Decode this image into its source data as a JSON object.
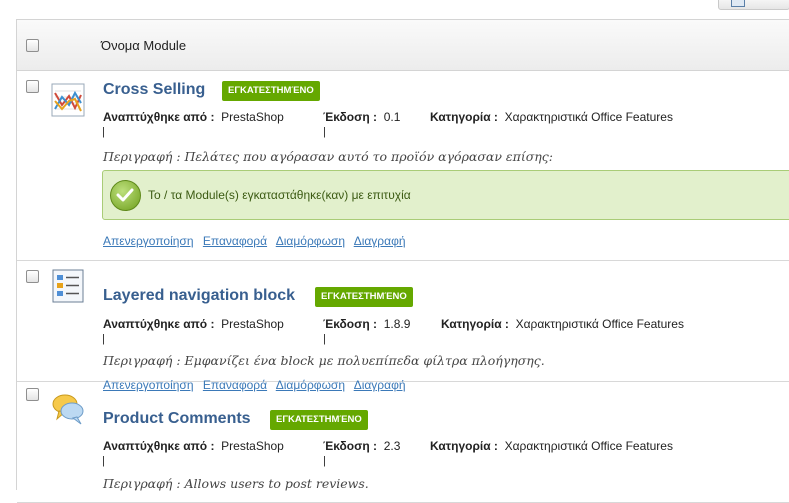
{
  "table": {
    "header_label": "Όνομα Module"
  },
  "labels": {
    "badge": "ΕΓΚΑΤΕΣΤΗΜΈΝΟ",
    "author": "Αναπτύχθηκε από :",
    "version": "Έκδοση :",
    "category": "Κατηγορία :",
    "desc_prefix": "Περιγραφή :"
  },
  "modules": [
    {
      "name": "Cross Selling",
      "author": "PrestaShop",
      "version": "0.1",
      "category": "Χαρακτηριστικά Office Features",
      "description": "Πελάτες που αγόρασαν αυτό το προϊόν αγόρασαν επίσης:",
      "icon": "cross-selling-chart-icon"
    },
    {
      "name": "Layered navigation block",
      "author": "PrestaShop",
      "version": "1.8.9",
      "category": "Χαρακτηριστικά Office Features",
      "description": "Εμφανίζει ένα block με πολυεπίπεδα φίλτρα πλοήγησης.",
      "icon": "layered-navigation-list-icon"
    },
    {
      "name": "Product Comments",
      "author": "PrestaShop",
      "version": "2.3",
      "category": "Χαρακτηριστικά Office Features",
      "description": "Allows users to post reviews.",
      "icon": "comments-speech-bubbles-icon"
    }
  ],
  "success_message": "Το / τα Module(s) εγκαταστάθηκε(καν) με επιτυχία",
  "actions": {
    "disable": "Απενεργοποίηση",
    "reset": "Επαναφορά",
    "configure": "Διαμόρφωση",
    "delete": "Διαγραφή"
  },
  "colors": {
    "badge": "#65a800",
    "link": "#3b79b8",
    "module_name": "#385f8f",
    "success_bg": "#e2f0cc"
  }
}
